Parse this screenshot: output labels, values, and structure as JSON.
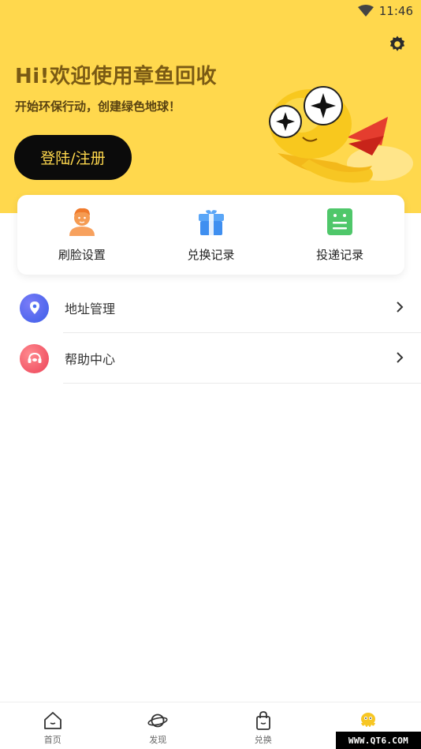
{
  "status_bar": {
    "time": "11:46"
  },
  "header": {
    "greeting": "Hi!欢迎使用章鱼回收",
    "subtitle": "开始环保行动，创建绿色地球！",
    "login_label": "登陆/注册",
    "settings_icon": "gear-icon"
  },
  "quick_actions": [
    {
      "label": "刷脸设置",
      "icon": "face-setting-icon",
      "color": "#f59b52"
    },
    {
      "label": "兑换记录",
      "icon": "gift-icon",
      "color": "#3f8ff0"
    },
    {
      "label": "投递记录",
      "icon": "delivery-record-icon",
      "color": "#4fc76a"
    }
  ],
  "menu": [
    {
      "label": "地址管理",
      "icon": "location-pin-icon",
      "color": "#4a6ff0"
    },
    {
      "label": "帮助中心",
      "icon": "help-headset-icon",
      "color": "#f0566b"
    }
  ],
  "tab_bar": [
    {
      "label": "首页",
      "icon": "home-icon"
    },
    {
      "label": "发现",
      "icon": "planet-icon"
    },
    {
      "label": "兑换",
      "icon": "shopping-bag-icon"
    },
    {
      "label": "",
      "icon": "octopus-icon",
      "active": true
    }
  ],
  "watermark": "WWW.QT6.COM",
  "colors": {
    "brand_yellow": "#ffd84d",
    "login_bg": "#0b0b0b"
  }
}
